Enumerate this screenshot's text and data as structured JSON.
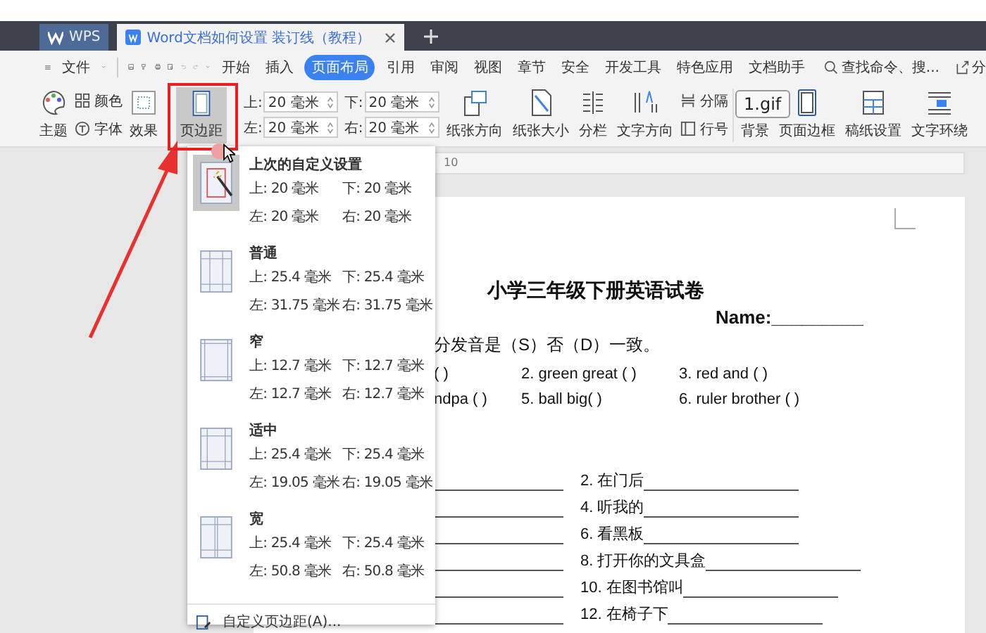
{
  "tabs": [
    {
      "label": "WPS",
      "kind": "home",
      "selected": false
    },
    {
      "label": "Word文档如何设置 装订线（教程）",
      "kind": "doc",
      "selected": true
    }
  ],
  "menu": {
    "file": "文件",
    "items": [
      {
        "label": "开始",
        "selected": false
      },
      {
        "label": "插入",
        "selected": false
      },
      {
        "label": "页面布局",
        "selected": true
      },
      {
        "label": "引用",
        "selected": false
      },
      {
        "label": "审阅",
        "selected": false
      },
      {
        "label": "视图",
        "selected": false
      },
      {
        "label": "章节",
        "selected": false
      },
      {
        "label": "安全",
        "selected": false
      },
      {
        "label": "开发工具",
        "selected": false
      },
      {
        "label": "特色应用",
        "selected": false
      },
      {
        "label": "文档助手",
        "selected": false
      }
    ],
    "search": "查找命令、搜...",
    "share": "分"
  },
  "ribbon": {
    "theme": "主题",
    "colors": "颜色",
    "font": "字体",
    "effect": "效果",
    "margins_button": {
      "label": "页边距",
      "selected": true
    },
    "fields": [
      {
        "label": "上:",
        "value": "20 毫米"
      },
      {
        "label": "下:",
        "value": "20 毫米"
      },
      {
        "label": "左:",
        "value": "20 毫米"
      },
      {
        "label": "右:",
        "value": "20 毫米"
      }
    ],
    "tools": [
      {
        "label": "纸张方向",
        "kind": "orientation"
      },
      {
        "label": "纸张大小",
        "kind": "size"
      },
      {
        "label": "分栏",
        "kind": "columns"
      },
      {
        "label": "文字方向",
        "kind": "direction"
      }
    ],
    "breaks": "分隔",
    "line_numbers": "行号",
    "tools2": [
      {
        "label": "背景",
        "kind": "background"
      },
      {
        "label": "页面边框",
        "kind": "border"
      },
      {
        "label": "稿纸设置",
        "kind": "grid"
      },
      {
        "label": "文字环绕",
        "kind": "wrap"
      }
    ]
  },
  "tooltip": "1.gif",
  "ruler": "10",
  "margin_menu": {
    "presets": [
      {
        "name": "上次的自定义设置",
        "kind": "custom",
        "selected": true,
        "top": "上: 20 毫米",
        "bottom": "下: 20 毫米",
        "left": "左: 20 毫米",
        "right": "右: 20 毫米"
      },
      {
        "name": "普通",
        "kind": "normal",
        "selected": false,
        "top": "上: 25.4 毫米",
        "bottom": "下: 25.4 毫米",
        "left": "左: 31.75 毫米",
        "right": "右: 31.75 毫米"
      },
      {
        "name": "窄",
        "kind": "narrow",
        "selected": false,
        "top": "上: 12.7 毫米",
        "bottom": "下: 12.7 毫米",
        "left": "左: 12.7 毫米",
        "right": "右: 12.7 毫米"
      },
      {
        "name": "适中",
        "kind": "moderate",
        "selected": false,
        "top": "上: 25.4 毫米",
        "bottom": "下: 25.4 毫米",
        "left": "左: 19.05 毫米",
        "right": "右: 19.05 毫米"
      },
      {
        "name": "宽",
        "kind": "wide",
        "selected": false,
        "top": "上: 25.4 毫米",
        "bottom": "下: 25.4 毫米",
        "left": "左: 50.8 毫米",
        "right": "右: 50.8 毫米"
      }
    ],
    "custom": "自定义页边距(A)..."
  },
  "document": {
    "title": "小学三年级下册英语试卷",
    "name": "Name:_________",
    "instruction": "分发音是（S）否（D）一致。",
    "phonics": [
      [
        "(    )",
        "2. green   great (    )",
        "3. red   and (   )"
      ],
      [
        "ndpa (   )",
        "5. ball   big(     )",
        "6. ruler   brother (   )"
      ]
    ],
    "translations": [
      "2.  在门后",
      "4.  听我的",
      "6.  看黑板",
      "8.  打开你的文具盒",
      "10.  在图书馆叫",
      "12.  在椅子下"
    ]
  }
}
